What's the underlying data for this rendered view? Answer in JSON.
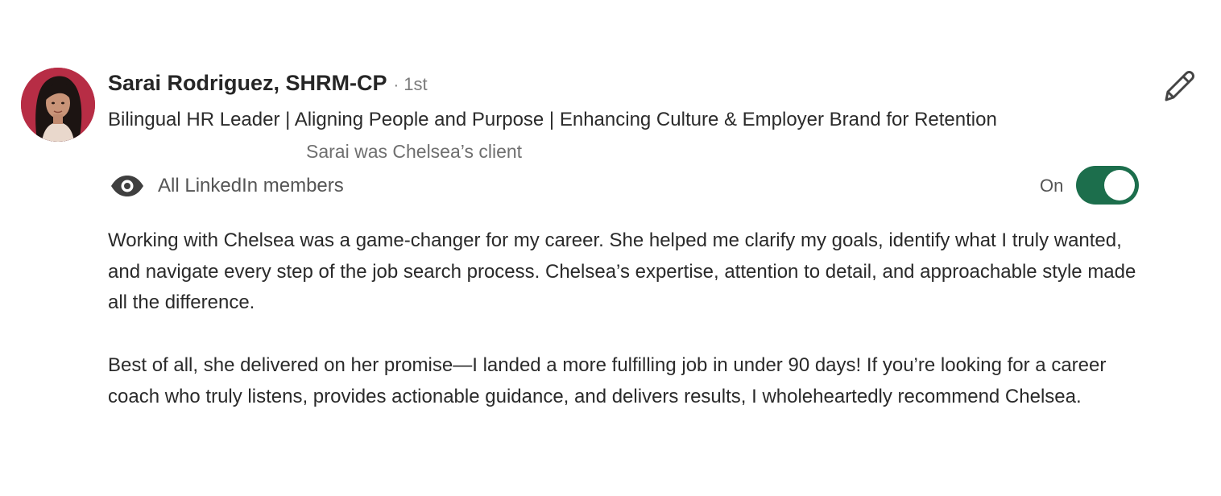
{
  "recommendation": {
    "author": {
      "name": "Sarai Rodriguez, SHRM-CP",
      "separator": "·",
      "connection_degree": "1st",
      "headline": "Bilingual HR Leader | Aligning People and Purpose | Enhancing Culture & Employer Brand for Retention",
      "avatar_icon": "profile-photo"
    },
    "relationship": "Sarai was Chelsea’s client",
    "edit_icon": "pencil-icon",
    "visibility": {
      "icon": "eye-icon",
      "label": "All LinkedIn members",
      "toggle_label": "On",
      "toggle_on": true,
      "toggle_color": "#1c6e4c"
    },
    "paragraphs": [
      "Working with Chelsea was a game-changer for my career. She helped me clarify my goals, identify what I truly wanted, and navigate every step of the job search process. Chelsea’s expertise, attention to detail, and approachable style made all the difference.",
      "Best of all, she delivered on her promise—I landed a more fulfilling job in under 90 days! If you’re looking for a career coach who truly listens, provides actionable guidance, and delivers results, I wholeheartedly recommend Chelsea."
    ]
  }
}
